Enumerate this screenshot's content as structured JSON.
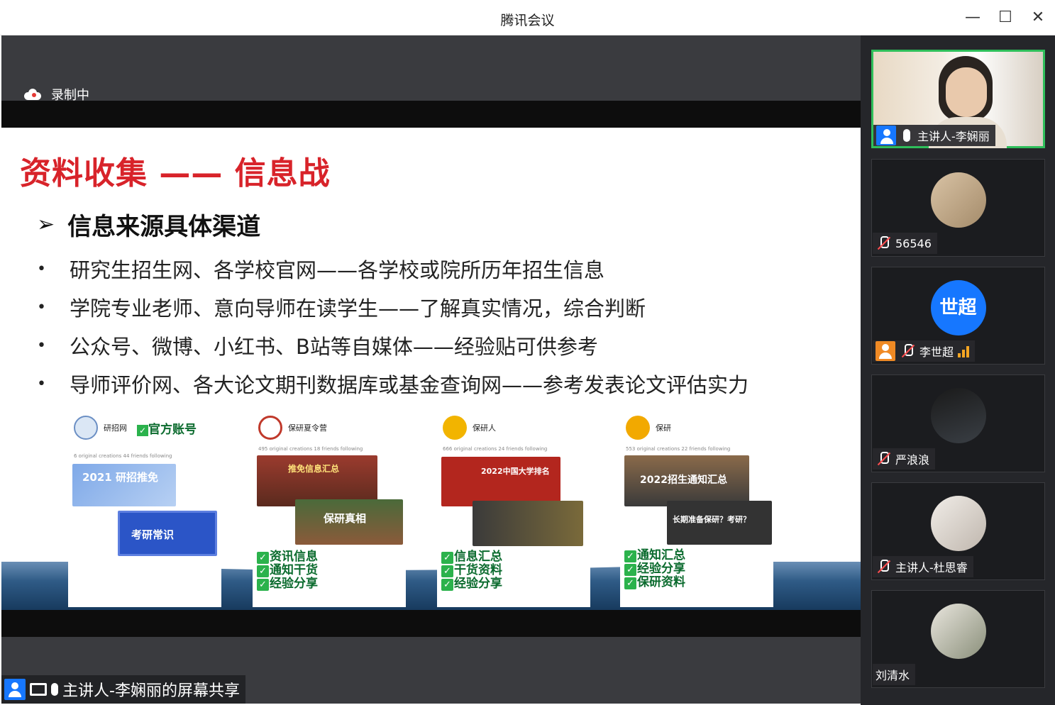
{
  "window": {
    "title": "腾讯会议",
    "minimize": "—",
    "maximize": "☐",
    "close": "✕"
  },
  "recording": {
    "label": "录制中"
  },
  "slide": {
    "title": "资料收集 —— 信息战",
    "subheading": "信息来源具体渠道",
    "bullets": [
      "研究生招生网、各学校官网——各学校或院所历年招生信息",
      "学院专业老师、意向导师在读学生——了解真实情况，综合判断",
      "公众号、微博、小红书、B站等自媒体——经验贴可供参考",
      "导师评价网、各大论文期刊数据库或基金查询网——参考发表论文评估实力"
    ],
    "cards": [
      {
        "name": "研招网",
        "badge": "官方账号",
        "stats": "6 original creations   44 friends following",
        "thumb1": "2021 研招推免",
        "thumb2": "考研常识",
        "tags": []
      },
      {
        "name": "保研夏令营",
        "badge": "",
        "stats": "495 original creations   18 friends following",
        "thumb1": "推免信息汇总",
        "thumb2": "保研真相",
        "tags": [
          "资讯信息",
          "通知干货",
          "经验分享"
        ]
      },
      {
        "name": "保研人",
        "badge": "",
        "stats": "666 original creations   24 friends following",
        "thumb1": "2022中国大学排名",
        "thumb2": "",
        "tags": [
          "信息汇总",
          "干货资料",
          "经验分享"
        ]
      },
      {
        "name": "保研",
        "badge": "",
        "stats": "553 original creations   22 friends following",
        "thumb1": "2022招生通知汇总",
        "thumb2": "长期准备保研？考研？",
        "tags": [
          "通知汇总",
          "经验分享",
          "保研资料"
        ]
      }
    ]
  },
  "share_bar": {
    "label": "主讲人-李娴丽的屏幕共享"
  },
  "participants": [
    {
      "name": "主讲人-李娴丽",
      "mic": "on",
      "active": true
    },
    {
      "name": "56546",
      "mic": "muted",
      "active": false
    },
    {
      "name": "李世超",
      "mic": "muted",
      "avatar_text": "世超",
      "active": false
    },
    {
      "name": "严浪浪",
      "mic": "muted",
      "active": false
    },
    {
      "name": "主讲人-杜思睿",
      "mic": "muted",
      "active": false
    },
    {
      "name": "刘清水",
      "mic": "none",
      "active": false
    }
  ],
  "colors": {
    "title_red": "#d8232a",
    "accent_blue": "#1677ff",
    "active_green": "#2fbf5b",
    "check_green": "#2bb24c"
  }
}
